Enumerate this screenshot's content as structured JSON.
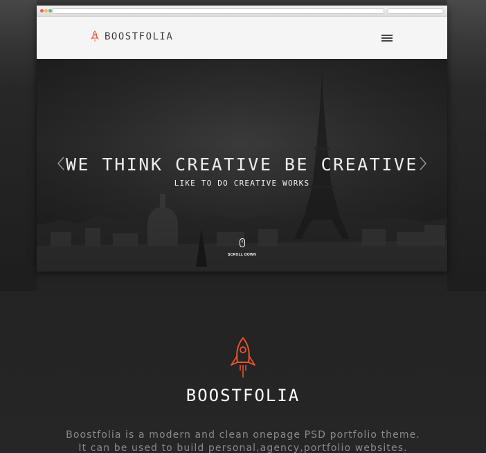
{
  "nav": {
    "brand": "BOOSTFOLIA"
  },
  "hero": {
    "title": "WE THINK CREATIVE BE CREATIVE",
    "subtitle": "LIKE TO DO CREATIVE WORKS",
    "scroll_label": "SCROLL DOWN"
  },
  "about": {
    "brand": "BOOSTFOLIA",
    "line1": "Boostfolia is a modern and clean onepage PSD  portfolio theme.",
    "line2": "It can be used to build personal,agency,portfolio websites."
  },
  "colors": {
    "accent": "#e8532a",
    "navbar_bg": "#f6f5f5",
    "page_bg": "#262626"
  }
}
